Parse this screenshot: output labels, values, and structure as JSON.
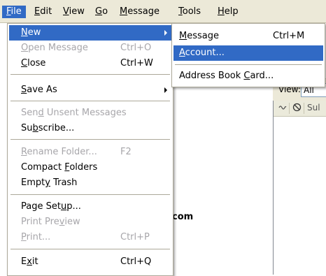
{
  "menubar": {
    "items": [
      {
        "pre": "",
        "key": "F",
        "post": "ile"
      },
      {
        "pre": "",
        "key": "E",
        "post": "dit"
      },
      {
        "pre": "",
        "key": "V",
        "post": "iew"
      },
      {
        "pre": "",
        "key": "G",
        "post": "o"
      },
      {
        "pre": "",
        "key": "M",
        "post": "essage"
      },
      {
        "pre": "",
        "key": "T",
        "post": "ools"
      },
      {
        "pre": "",
        "key": "H",
        "post": "elp"
      }
    ]
  },
  "file_menu": {
    "new": {
      "pre": "",
      "key": "N",
      "post": "ew"
    },
    "open_message": {
      "pre": "",
      "key": "O",
      "post": "pen Message",
      "accel": "Ctrl+O"
    },
    "close": {
      "pre": "",
      "key": "C",
      "post": "lose",
      "accel": "Ctrl+W"
    },
    "save_as": {
      "pre": "",
      "key": "S",
      "post": "ave As"
    },
    "send_unsent": {
      "pre": "Sen",
      "key": "d",
      "post": " Unsent Messages"
    },
    "subscribe": {
      "pre": "Su",
      "key": "b",
      "post": "scribe..."
    },
    "rename_folder": {
      "pre": "",
      "key": "R",
      "post": "ename Folder...",
      "accel": "F2"
    },
    "compact_folders": {
      "pre": "Compact ",
      "key": "F",
      "post": "olders"
    },
    "empty_trash": {
      "pre": "Empt",
      "key": "y",
      "post": " Trash"
    },
    "page_setup": {
      "pre": "Page Set",
      "key": "u",
      "post": "p..."
    },
    "print_preview": {
      "pre": "Print Pre",
      "key": "v",
      "post": "iew"
    },
    "print": {
      "pre": "",
      "key": "P",
      "post": "rint...",
      "accel": "Ctrl+P"
    },
    "exit": {
      "pre": "E",
      "key": "x",
      "post": "it",
      "accel": "Ctrl+Q"
    }
  },
  "new_submenu": {
    "message": {
      "pre": "",
      "key": "M",
      "post": "essage",
      "accel": "Ctrl+M"
    },
    "account": {
      "pre": "",
      "key": "A",
      "post": "ccount..."
    },
    "address_book_card": {
      "pre": "Address Book ",
      "key": "C",
      "post": "ard..."
    }
  },
  "background": {
    "view_label": "View:",
    "view_value": "All",
    "subject_col": "Sul",
    "account_text": "com"
  },
  "colors": {
    "highlight": "#316ac5",
    "menubar_bg": "#ece9d8",
    "disabled_text": "#a7a6aa"
  },
  "icons": [
    "thread-icon",
    "junk-status-icon",
    "submenu-arrow-icon"
  ]
}
